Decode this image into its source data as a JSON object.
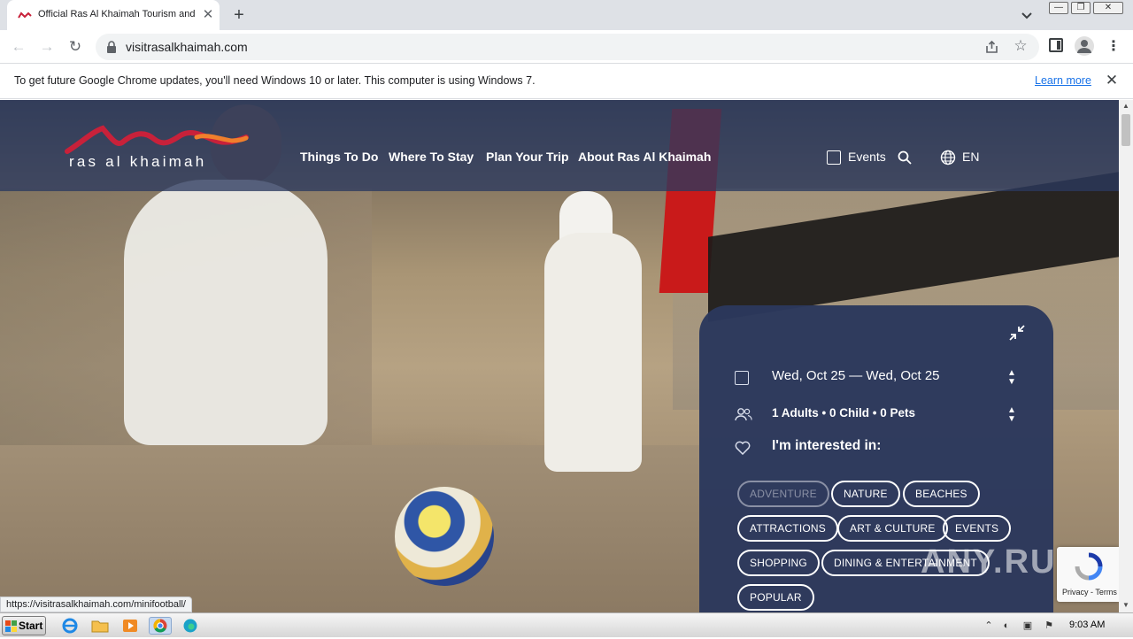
{
  "browser": {
    "tab_title": "Official Ras Al Khaimah Tourism and V",
    "tab_close": "✕",
    "new_tab": "+",
    "url": "visitrasalkhaimah.com",
    "window_min": "—",
    "window_restore": "❐",
    "window_close": "✕"
  },
  "infobar": {
    "message": "To get future Google Chrome updates, you'll need Windows 10 or later. This computer is using Windows 7.",
    "learn_more": "Learn more",
    "close": "✕"
  },
  "site": {
    "logo_text": "ras al khaimah",
    "nav": [
      "Things To Do",
      "Where To Stay",
      "Plan Your Trip",
      "About Ras Al Khaimah"
    ],
    "events_label": "Events",
    "lang_label": "EN"
  },
  "booking": {
    "dates": "Wed, Oct 25 — Wed, Oct 25",
    "guests": "1 Adults  •  0 Child  •  0 Pets",
    "interest_label": "I'm interested in:",
    "chips": [
      "ADVENTURE",
      "NATURE",
      "BEACHES",
      "ATTRACTIONS",
      "ART & CULTURE",
      "EVENTS",
      "SHOPPING",
      "DINING & ENTERTAINMENT",
      "POPULAR"
    ]
  },
  "recaptcha": {
    "text": "Privacy - Terms"
  },
  "status_url": "https://visitrasalkhaimah.com/minifootball/",
  "watermark": "ANY.RUN",
  "taskbar": {
    "start_label": "Start",
    "clock": "9:03 AM",
    "icons": [
      "ie-icon",
      "folder-icon",
      "media-player-icon",
      "chrome-icon",
      "edge-icon"
    ]
  },
  "colors": {
    "site_header": "#2b3a5f",
    "panel": "#2b385c",
    "logo_red": "#c8213a",
    "logo_orange": "#f07f2c",
    "flag_red": "#c91a1a"
  }
}
